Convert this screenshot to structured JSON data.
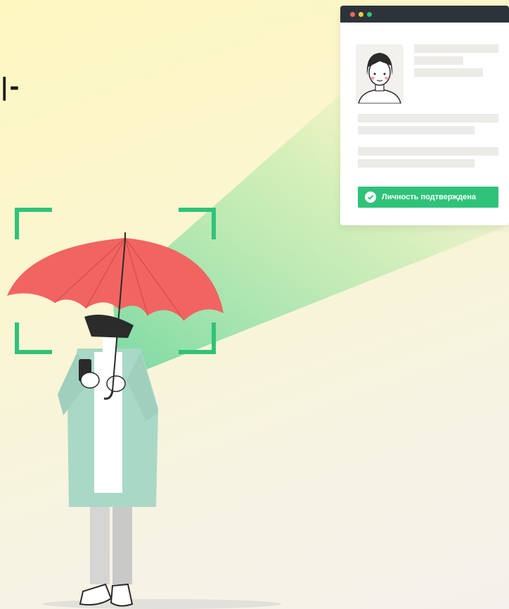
{
  "page_fragment_text": "|-",
  "id_window": {
    "badge_text": "Личность подтверждена",
    "badge_color": "#2fc37a",
    "bar_dots": [
      "#f2645a",
      "#f7c948",
      "#2fc37a"
    ]
  },
  "illustration": {
    "subject": "woman-with-red-umbrella-holding-phone",
    "umbrella_color": "#f26461",
    "frame_color": "#2fc37a",
    "coat_color": "#a9d8c6"
  }
}
